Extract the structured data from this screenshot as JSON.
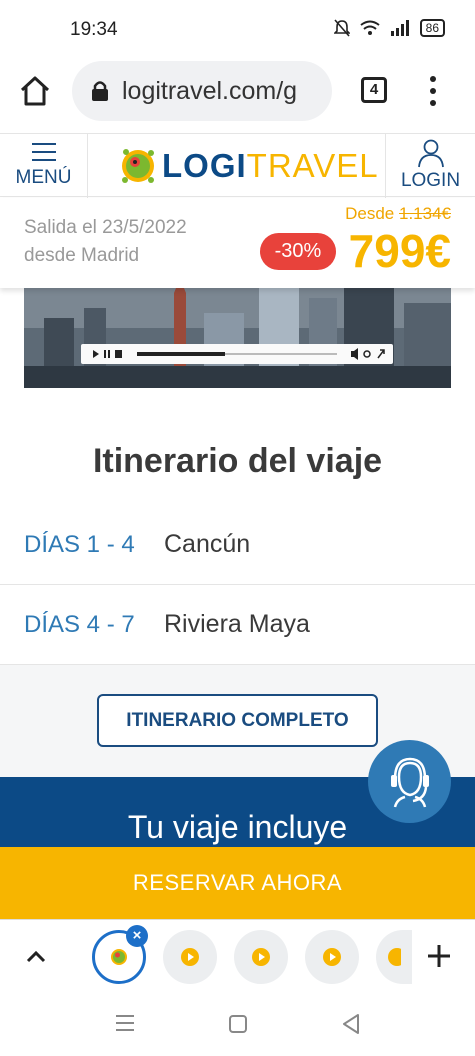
{
  "status": {
    "time": "19:34",
    "battery": "86"
  },
  "browser": {
    "url": "logitravel.com/g",
    "tab_count": "4"
  },
  "header": {
    "menu_label": "MENÚ",
    "logo_logi": "LOGI",
    "logo_travel": "TRAVEL",
    "login_label": "LOGIN"
  },
  "offer": {
    "departure_line1": "Salida el 23/5/2022",
    "departure_line2": "desde Madrid",
    "desde_label": "Desde",
    "old_price": "1.134€",
    "discount": "-30%",
    "price": "799€"
  },
  "itinerary": {
    "title": "Itinerario del viaje",
    "rows": [
      {
        "days": "DÍAS 1 - 4",
        "place": "Cancún"
      },
      {
        "days": "DÍAS 4 - 7",
        "place": "Riviera Maya"
      }
    ],
    "full_button": "ITINERARIO COMPLETO"
  },
  "includes": {
    "title": "Tu viaje incluye"
  },
  "cta": {
    "reserve": "RESERVAR AHORA"
  },
  "colors": {
    "brand_blue": "#0c4a86",
    "brand_yellow": "#f7b500",
    "discount_red": "#e8423b",
    "link_blue": "#2f7ab5"
  }
}
